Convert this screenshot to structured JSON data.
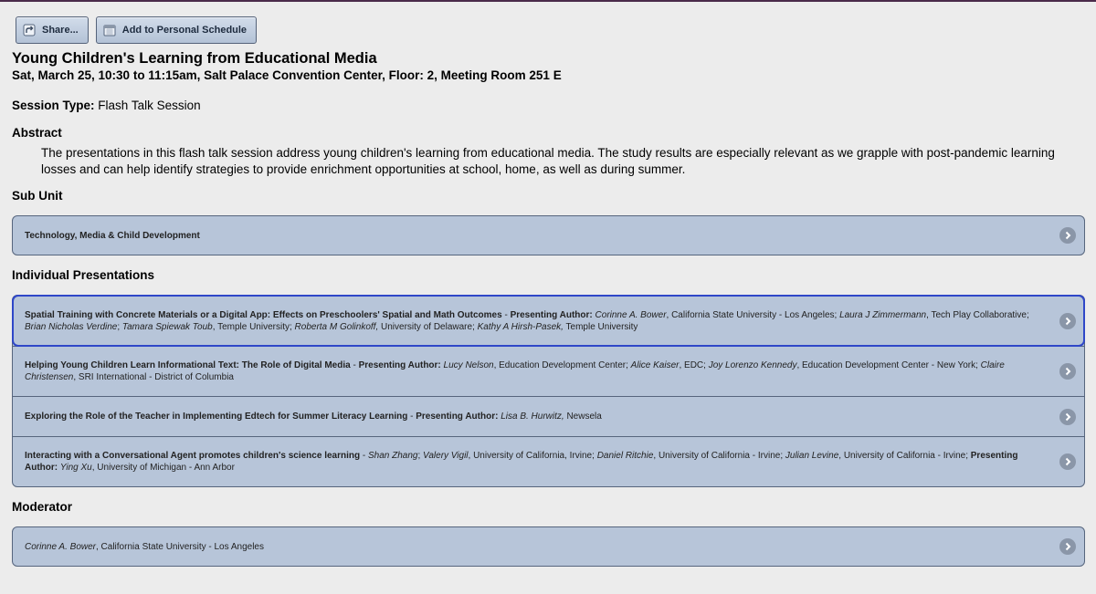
{
  "toolbar": {
    "share_label": "Share...",
    "schedule_label": "Add to Personal Schedule"
  },
  "session": {
    "title": "Young Children's Learning from Educational Media",
    "datetime_location": "Sat, March 25, 10:30 to 11:15am, Salt Palace Convention Center, Floor: 2, Meeting Room 251 E",
    "type_label": "Session Type:",
    "type_value": "Flash Talk Session",
    "abstract_heading": "Abstract",
    "abstract_text": "The presentations in this flash talk session address young children's learning from educational media. The study results are especially relevant as we grapple with post-pandemic learning losses and can help identify strategies to provide enrichment opportunities at school, home, as well as during summer."
  },
  "sub_unit": {
    "heading": "Sub Unit",
    "item": "Technology, Media & Child Development"
  },
  "presentations": {
    "heading": "Individual Presentations",
    "items": [
      {
        "title": "Spatial Training with Concrete Materials or a Digital App: Effects on Preschoolers' Spatial and Math Outcomes",
        "sep1": " - ",
        "presenting_label": "Presenting Author:",
        "p1_name": "Corinne A. Bower",
        "p1_aff": ", California State University - Los Angeles; ",
        "p2_name": "Laura J Zimmermann",
        "p2_aff": ", Tech Play Collaborative; ",
        "p3_name": "Brian Nicholas Verdine",
        "p3_sep": "; ",
        "p4_name": "Tamara Spiewak Toub",
        "p4_aff": ", Temple University; ",
        "p5_name": "Roberta M Golinkoff,",
        "p5_aff": " University of Delaware; ",
        "p6_name": "Kathy A Hirsh-Pasek,",
        "p6_aff": " Temple University"
      },
      {
        "title": "Helping Young Children Learn Informational Text: The Role of Digital Media",
        "sep1": " - ",
        "presenting_label": "Presenting Author:",
        "p1_name": "Lucy Nelson",
        "p1_aff": ", Education Development Center; ",
        "p2_name": "Alice Kaiser",
        "p2_aff": ", EDC; ",
        "p3_name": "Joy Lorenzo Kennedy",
        "p3_aff": ", Education Development Center - New York; ",
        "p4_name": "Claire Christensen",
        "p4_aff": ", SRI International - District of Columbia"
      },
      {
        "title": "Exploring the Role of the Teacher in Implementing Edtech for Summer Literacy Learning",
        "sep1": " - ",
        "presenting_label": "Presenting Author:",
        "p1_name": "Lisa B. Hurwitz,",
        "p1_aff": " Newsela"
      },
      {
        "title": "Interacting with a Conversational Agent promotes children's science learning",
        "sep1": " - ",
        "p1_name": "Shan Zhang",
        "p1_sep": "; ",
        "p2_name": "Valery Vigil",
        "p2_aff": ", University of California, Irvine; ",
        "p3_name": "Daniel Ritchie",
        "p3_aff": ", University of California - Irvine; ",
        "p4_name": "Julian Levine",
        "p4_aff": ", University of California - Irvine; ",
        "presenting_label": "Presenting Author:",
        "p5_name": "Ying Xu",
        "p5_aff": ", University of Michigan - Ann Arbor"
      }
    ]
  },
  "moderator": {
    "heading": "Moderator",
    "name": "Corinne A. Bower",
    "aff": ", California State University - Los Angeles"
  },
  "colors": {
    "card_bg": "#b7c5d9",
    "selected_outline": "#2f47c8",
    "chevron_bg": "#8a96a8"
  }
}
